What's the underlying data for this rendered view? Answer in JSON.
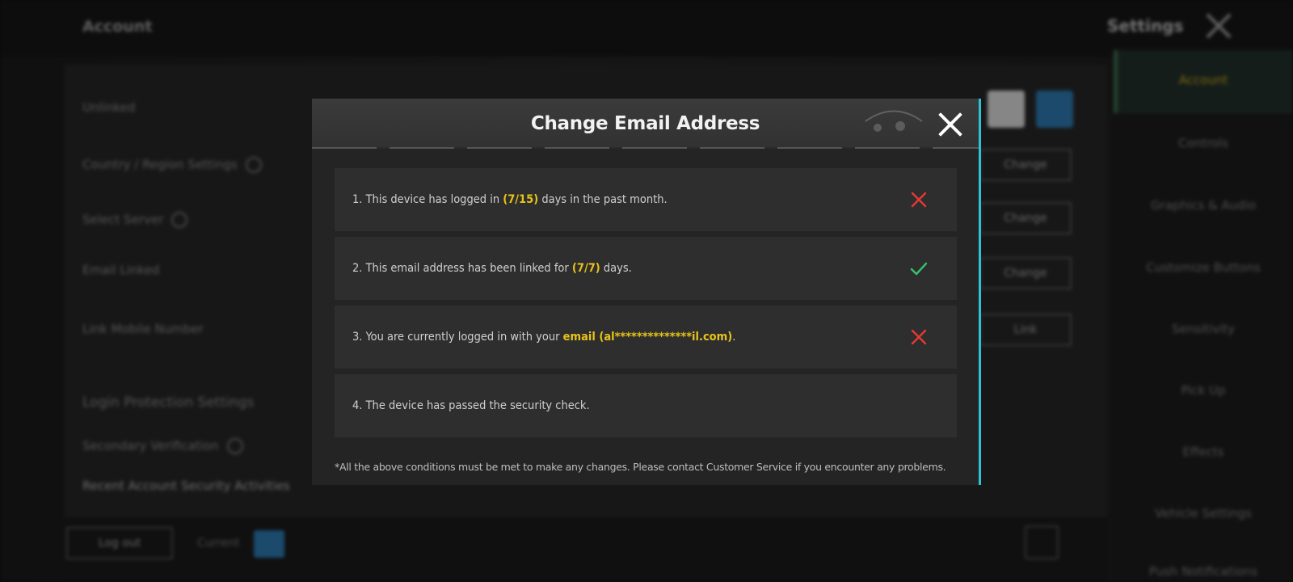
{
  "background": {
    "account_title": "Account",
    "settings_title": "Settings",
    "rows": [
      "Unlinked",
      "Country / Region Settings",
      "Select Server",
      "Email Linked",
      "Link Mobile Number",
      "Login Protection Settings",
      "Secondary Verification",
      "Recent Account Security Activities"
    ],
    "buttons": [
      "Change",
      "Change",
      "Change",
      "Link"
    ],
    "log_out": "Log out",
    "current": "Current",
    "sidebar": [
      "Account",
      "Controls",
      "Graphics & Audio",
      "Customize Buttons",
      "Sensitivity",
      "Pick Up",
      "Effects",
      "Vehicle Settings",
      "Push Notifications"
    ]
  },
  "modal": {
    "title": "Change Email Address",
    "conditions": [
      {
        "prefix": "1. This device has logged in ",
        "highlight": "(7/15)",
        "suffix": " days in the past month.",
        "status": "fail"
      },
      {
        "prefix": "2. This email address has been linked for ",
        "highlight": "(7/7)",
        "suffix": " days.",
        "status": "pass"
      },
      {
        "prefix": "3. You are currently logged in with your ",
        "highlight": "email (al**************il.com)",
        "suffix": ".",
        "status": "fail"
      },
      {
        "prefix": "4. The device has passed the security check.",
        "highlight": "",
        "suffix": "",
        "status": "none"
      }
    ],
    "footnote": "*All the above conditions must be met to make any changes. Please contact Customer Service if you encounter any problems."
  },
  "colors": {
    "highlight": "#e8c31a",
    "fail": "#e53935",
    "pass": "#36c46e",
    "accent_edge": "#2bc4d6"
  },
  "icons": {
    "fail": "x-icon",
    "pass": "check-icon",
    "close": "close-icon"
  }
}
